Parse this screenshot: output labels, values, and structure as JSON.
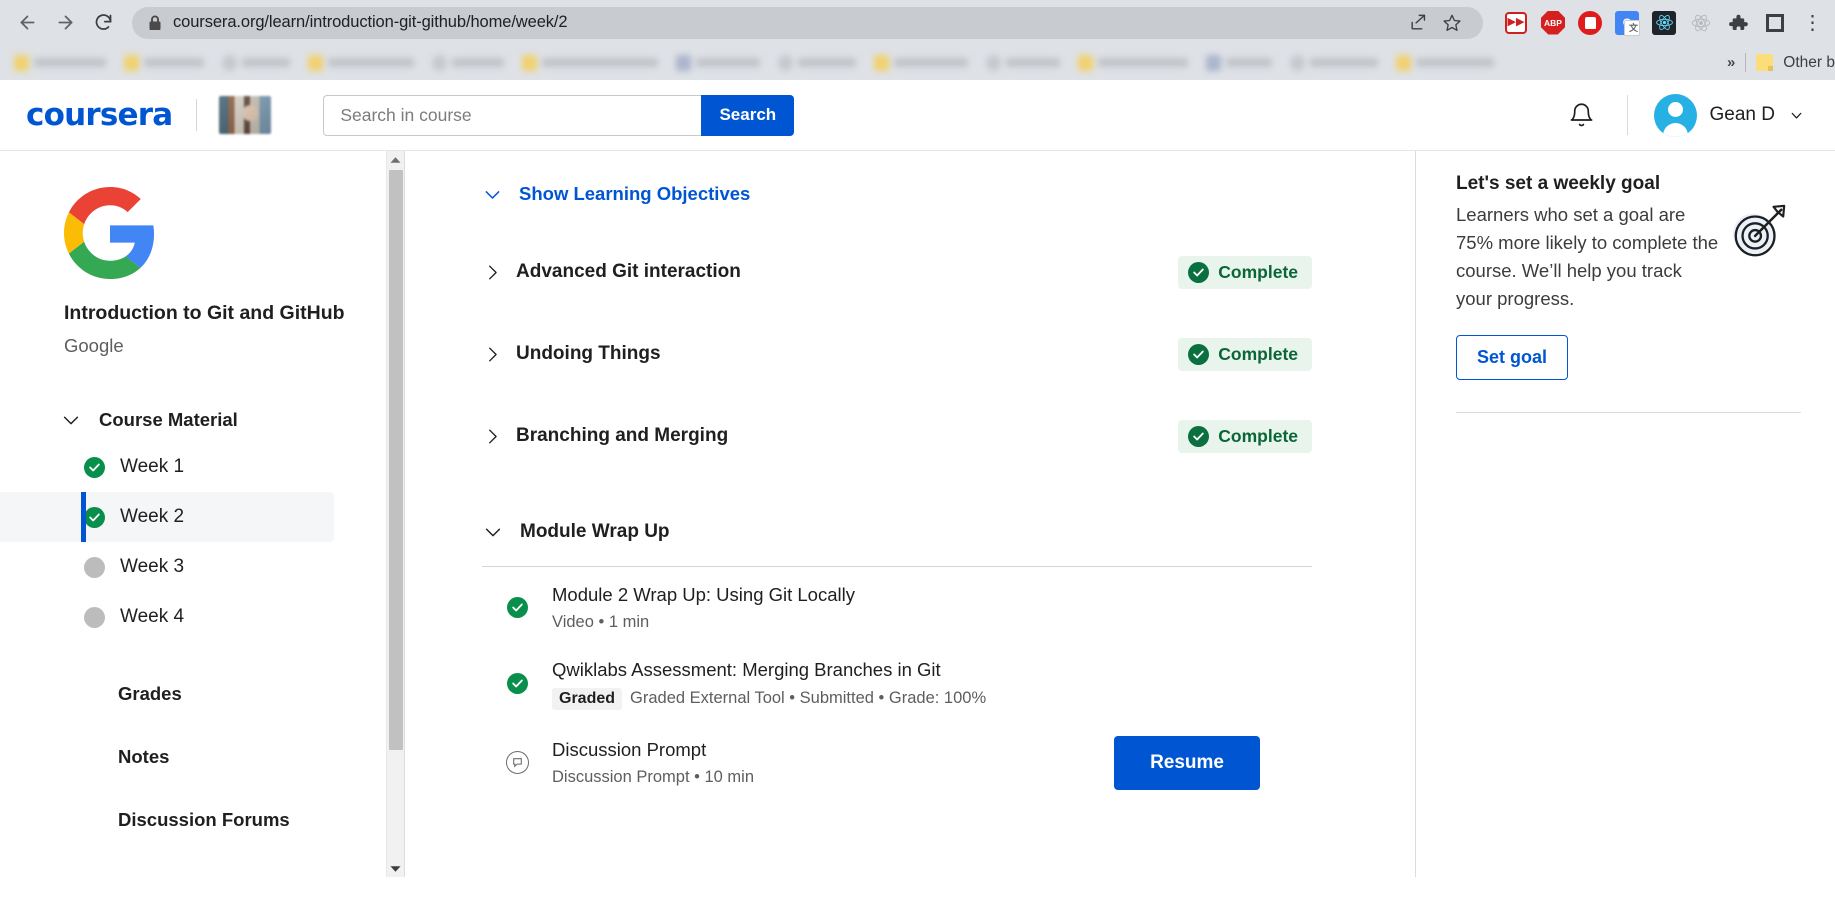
{
  "browser": {
    "back_label": "Back",
    "forward_label": "Forward",
    "reload_label": "Reload",
    "url": "coursera.org/learn/introduction-git-github/home/week/2",
    "lock_icon": "lock-icon",
    "share_icon": "share-icon",
    "bookmark_star_icon": "star-icon",
    "extensions": [
      {
        "name": "fastforward-extension-icon",
        "label": "»"
      },
      {
        "name": "adblock-plus-extension-icon",
        "label": "ABP"
      },
      {
        "name": "blocker-extension-icon",
        "label": ""
      },
      {
        "name": "google-translate-extension-icon",
        "label": "G"
      },
      {
        "name": "react-devtools-extension-icon",
        "label": ""
      },
      {
        "name": "disabled-extension-icon",
        "label": ""
      },
      {
        "name": "extensions-puzzle-icon",
        "label": ""
      },
      {
        "name": "side-panel-icon",
        "label": ""
      }
    ],
    "bookmarks_overflow_label": "»",
    "other_bookmarks_label": "Other b"
  },
  "header": {
    "logo_text": "coursera",
    "course_thumbnail": "course-thumbnail-image",
    "search_placeholder": "Search in course",
    "search_value": "",
    "search_button": "Search",
    "notifications_icon": "bell-icon",
    "user_name": "Gean D",
    "user_caret_icon": "chevron-down-icon",
    "avatar": "user-avatar"
  },
  "sidebar": {
    "logo": "google-logo",
    "course_title": "Introduction to Git and GitHub",
    "partner": "Google",
    "section_label": "Course Material",
    "section_chevron": "chevron-down-icon",
    "weeks": [
      {
        "label": "Week 1",
        "state": "complete"
      },
      {
        "label": "Week 2",
        "state": "complete",
        "active": true
      },
      {
        "label": "Week 3",
        "state": "incomplete"
      },
      {
        "label": "Week 4",
        "state": "incomplete"
      }
    ],
    "links": [
      {
        "label": "Grades"
      },
      {
        "label": "Notes"
      },
      {
        "label": "Discussion Forums"
      }
    ],
    "scrollbar": "vertical-scrollbar"
  },
  "main": {
    "learning_objectives_label": "Show Learning Objectives",
    "learning_objectives_chevron": "chevron-down-icon",
    "lessons": [
      {
        "title": "Advanced Git interaction",
        "status": "Complete",
        "chevron": "chevron-right-icon"
      },
      {
        "title": "Undoing Things",
        "status": "Complete",
        "chevron": "chevron-right-icon"
      },
      {
        "title": "Branching and Merging",
        "status": "Complete",
        "chevron": "chevron-right-icon"
      }
    ],
    "wrapup": {
      "title": "Module Wrap Up",
      "chevron": "chevron-down-icon",
      "items": [
        {
          "title": "Module 2 Wrap Up: Using Git Locally",
          "meta": "Video • 1 min",
          "icon": "check-circle-icon",
          "tag": ""
        },
        {
          "title": "Qwiklabs Assessment: Merging Branches in Git",
          "meta": "Graded External Tool • Submitted • Grade: 100%",
          "icon": "check-circle-icon",
          "tag": "Graded"
        },
        {
          "title": "Discussion Prompt",
          "meta": "Discussion Prompt • 10 min",
          "icon": "discussion-icon",
          "tag": "",
          "action": "Resume"
        }
      ]
    }
  },
  "right_panel": {
    "title": "Let's set a weekly goal",
    "body": "Learners who set a goal are 75% more likely to complete the course. We’ll help you track your progress.",
    "button": "Set goal",
    "icon": "target-goal-icon"
  },
  "colors": {
    "brand_blue": "#0056d2",
    "complete_green": "#098f4c",
    "badge_green_bg": "#e8f4ec",
    "badge_green_text": "#0a6636",
    "chrome_gray": "#dee1e6"
  }
}
